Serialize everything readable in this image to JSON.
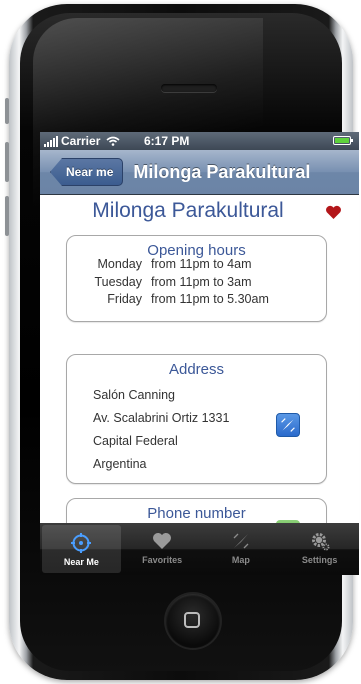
{
  "status_bar": {
    "carrier": "Carrier",
    "time": "6:17 PM"
  },
  "nav_bar": {
    "back_label": "Near me",
    "title": "Milonga Parakultural"
  },
  "place": {
    "name": "Milonga Parakultural",
    "favorite_icon": "heart-icon",
    "accent_color": "#3c5898"
  },
  "opening_hours": {
    "title": "Opening hours",
    "rows": [
      {
        "day": "Monday",
        "hours": "from 11pm to 4am"
      },
      {
        "day": "Tuesday",
        "hours": "from 11pm to 3am"
      },
      {
        "day": "Friday",
        "hours": "from 11pm to 5.30am"
      }
    ]
  },
  "address": {
    "title": "Address",
    "lines": [
      "Salón Canning",
      "Av. Scalabrini Ortiz 1331",
      "Capital Federal",
      "Argentina"
    ],
    "map_icon": "compass-icon"
  },
  "phone": {
    "title": "Phone number",
    "call_icon": "phone-icon"
  },
  "tab_bar": {
    "tabs": [
      {
        "label": "Near Me",
        "icon": "target-icon",
        "active": true
      },
      {
        "label": "Favorites",
        "icon": "heart-icon",
        "active": false
      },
      {
        "label": "Map",
        "icon": "compass-icon",
        "active": false
      },
      {
        "label": "Settings",
        "icon": "gear-icon",
        "active": false
      }
    ]
  }
}
